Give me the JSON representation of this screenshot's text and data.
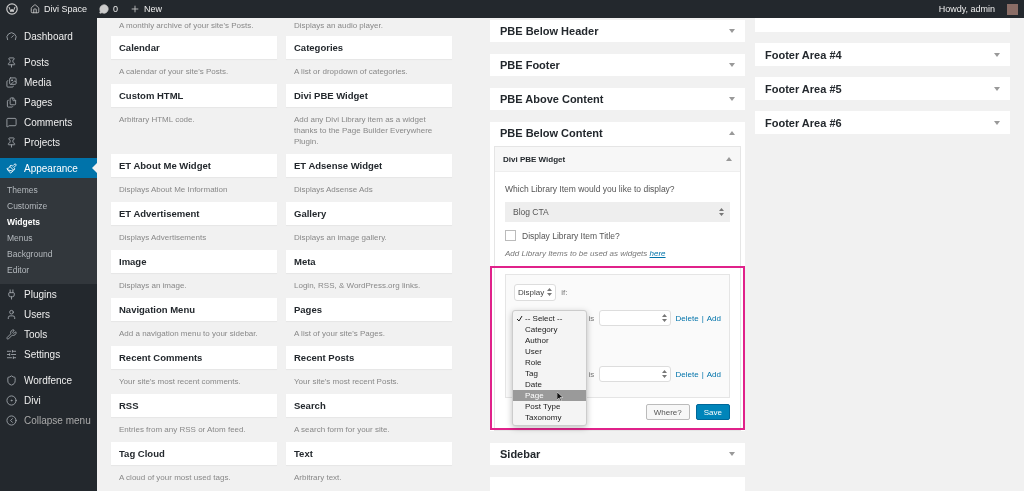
{
  "admin_bar": {
    "site": "Divi Space",
    "comments": "0",
    "new": "New",
    "greeting": "Howdy, admin"
  },
  "menu": [
    [
      {
        "label": "Dashboard",
        "selected": false
      }
    ],
    [
      {
        "label": "Posts",
        "selected": false
      },
      {
        "label": "Media",
        "selected": false
      },
      {
        "label": "Pages",
        "selected": false
      },
      {
        "label": "Comments",
        "selected": false
      },
      {
        "label": "Projects",
        "selected": false
      }
    ],
    [
      {
        "label": "Appearance",
        "selected": true,
        "children": [
          {
            "label": "Themes",
            "selected": false
          },
          {
            "label": "Customize",
            "selected": false
          },
          {
            "label": "Widgets",
            "selected": true
          },
          {
            "label": "Menus",
            "selected": false
          },
          {
            "label": "Background",
            "selected": false
          },
          {
            "label": "Editor",
            "selected": false
          }
        ]
      },
      {
        "label": "Plugins",
        "selected": false
      },
      {
        "label": "Users",
        "selected": false
      },
      {
        "label": "Tools",
        "selected": false
      },
      {
        "label": "Settings",
        "selected": false
      }
    ],
    [
      {
        "label": "Wordfence",
        "selected": false
      },
      {
        "label": "Divi",
        "selected": false
      },
      {
        "label": "Collapse menu",
        "selected": false
      }
    ]
  ],
  "available_widgets": {
    "top_descriptions": [
      "A monthly archive of your site's Posts.",
      "Displays an audio player."
    ],
    "items": [
      {
        "title": "Calendar",
        "description": "A calendar of your site's Posts."
      },
      {
        "title": "Categories",
        "description": "A list or dropdown of categories."
      },
      {
        "title": "Custom HTML",
        "description": "Arbitrary HTML code."
      },
      {
        "title": "Divi PBE Widget",
        "description": "Add any Divi Library item as a widget thanks to the Page Builder Everywhere Plugin."
      },
      {
        "title": "ET About Me Widget",
        "description": "Displays About Me Information"
      },
      {
        "title": "ET Adsense Widget",
        "description": "Displays Adsense Ads"
      },
      {
        "title": "ET Advertisement",
        "description": "Displays Advertisements"
      },
      {
        "title": "Gallery",
        "description": "Displays an image gallery."
      },
      {
        "title": "Image",
        "description": "Displays an image."
      },
      {
        "title": "Meta",
        "description": "Login, RSS, & WordPress.org links."
      },
      {
        "title": "Navigation Menu",
        "description": "Add a navigation menu to your sidebar."
      },
      {
        "title": "Pages",
        "description": "A list of your site's Pages."
      },
      {
        "title": "Recent Comments",
        "description": "Your site's most recent comments."
      },
      {
        "title": "Recent Posts",
        "description": "Your site's most recent Posts."
      },
      {
        "title": "RSS",
        "description": "Entries from any RSS or Atom feed."
      },
      {
        "title": "Search",
        "description": "A search form for your site."
      },
      {
        "title": "Tag Cloud",
        "description": "A cloud of your most used tags."
      },
      {
        "title": "Text",
        "description": "Arbitrary text."
      }
    ]
  },
  "widget_areas": [
    {
      "title": "PBE Below Header",
      "expanded": false
    },
    {
      "title": "PBE Footer",
      "expanded": false
    },
    {
      "title": "PBE Above Content",
      "expanded": false
    },
    {
      "title": "PBE Below Content",
      "expanded": true,
      "widget": {
        "title": "Divi PBE Widget",
        "expanded": true,
        "question": "Which Library Item would you like to display?",
        "library_item": "Blog CTA",
        "show_title": {
          "label": "Display Library Item Title?",
          "checked": false
        },
        "hint": "Add Library Items to be used as widgets",
        "hint_link": "here",
        "conditions": {
          "mode": "Display",
          "if": "if:",
          "rows": [
            {
              "operator": "is",
              "delete": "Delete",
              "separator": "|",
              "add": "Add",
              "open": true
            },
            {
              "operator": "is",
              "delete": "Delete",
              "separator": "|",
              "add": "Add",
              "open": false
            }
          ],
          "options": [
            {
              "label": "-- Select --",
              "checked": true,
              "highlighted": false
            },
            {
              "label": "Category",
              "checked": false,
              "highlighted": false
            },
            {
              "label": "Author",
              "checked": false,
              "highlighted": false
            },
            {
              "label": "User",
              "checked": false,
              "highlighted": false
            },
            {
              "label": "Role",
              "checked": false,
              "highlighted": false
            },
            {
              "label": "Tag",
              "checked": false,
              "highlighted": false
            },
            {
              "label": "Date",
              "checked": false,
              "highlighted": false
            },
            {
              "label": "Page",
              "checked": false,
              "highlighted": true
            },
            {
              "label": "Post Type",
              "checked": false,
              "highlighted": false
            },
            {
              "label": "Taxonomy",
              "checked": false,
              "highlighted": false
            }
          ]
        },
        "buttons": [
          "Where?",
          "Save"
        ]
      }
    },
    {
      "title": "Sidebar",
      "expanded": false
    }
  ],
  "footer_areas": [
    {
      "title": "Footer Area #4",
      "expanded": false
    },
    {
      "title": "Footer Area #5",
      "expanded": false
    },
    {
      "title": "Footer Area #6",
      "expanded": false
    }
  ]
}
